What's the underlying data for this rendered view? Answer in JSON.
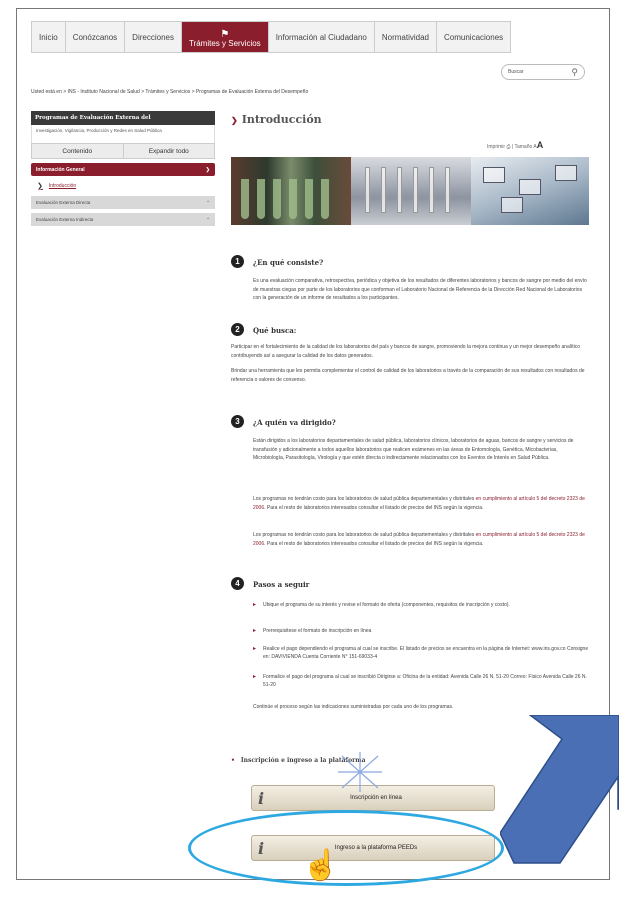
{
  "nav": {
    "items": [
      "Inicio",
      "Conózcanos",
      "Direcciones",
      "Trámites y Servicios",
      "Información al Ciudadano",
      "Normatividad",
      "Comunicaciones"
    ],
    "active_index": 3
  },
  "search": {
    "placeholder": "Buscar"
  },
  "breadcrumb": "Usted está en > INS - Instituto Nacional de Salud > Trámites y Servicios > Programas de Evaluación Externa del Desempeño",
  "sidebar": {
    "title": "Programas de Evaluación Externa del",
    "subtitle": "Investigación, Vigilancia, Producción y Redes en Salud Pública",
    "contents_label": "Contenido",
    "expand_label": "Expandir todo",
    "general_info": "Información General",
    "intro_link": "Introducción",
    "sections": [
      "Evaluación Externa Directa",
      "Evaluación Externa Indirecta"
    ]
  },
  "main": {
    "title": "Introducción",
    "print_label": "Imprimir",
    "size_label": "Tamaño",
    "steps": [
      {
        "num": "1",
        "title": "¿En qué consiste?",
        "text": "Es una evaluación comparativa, retrospectiva, periódica y objetiva de los resultados de diferentes laboratorios y bancos de sangre por medio del envío de muestras ciegas por parte de los laboratorios que conforman el Laboratorio Nacional de Referencia de la Dirección Red Nacional de Laboratorios con la generación de un informe de resultados a los participantes."
      },
      {
        "num": "2",
        "title": "Qué busca:",
        "text": "Participar en el fortalecimiento de la calidad de los laboratorios del país y bancos de sangre, promoviendo la mejora continua y un mejor desempeño analítico contribuyendo así a asegurar la calidad de los datos generados.",
        "text2": "Brindar una herramienta que les permita complementar el control de calidad de los laboratorios a través de la comparación de sus resultados con resultados de referencia o valores de consenso."
      },
      {
        "num": "3",
        "title": "¿A quién va dirigido?",
        "text": "Están dirigidos a los laboratorios departamentales de salud pública, laboratorios clínicos, laboratorios de aguas, bancos de sangre y servicios de transfusión y adicionalmente a todos aquellos laboratorios que realicen exámenes en las áreas de Entomología, Genética, Micobacterias, Microbiología, Parasitología, Virología y que estén directa o indirectamente relacionados con los Eventos de Interés en Salud Pública.",
        "text2_pre": "Los programas no tendrán costo para los laboratorios de salud pública departementales y distritales ",
        "text2_link": "en cumplimiento al artículo 5 del decreto 2323 de 2006",
        "text2_post": ". Para el resto de laboratorios interesados consultar el listado de precios del INS según la vigencia.",
        "text3_pre": "Los programas no tendrán costo para los laboratorios de salud pública departementales y distritales ",
        "text3_link": "en cumplimiento al artículo 5 del decreto 2323 de 2006",
        "text3_post": ". Para el resto de laboratorios interesados consultar el listado de precios del INS según la vigencia."
      },
      {
        "num": "4",
        "title": "Pasos a seguir",
        "bullets": [
          "Ubique el programa de su interés y revise el formato de oferta (componentes, requisitos de inscripción y costo).",
          "Prerrequisitese el formato de inscripción en línea",
          "Realice el pago dependiendo el programa al cual se inscribe. El listado de precios se encuentra en la página de Internet: www.ins.gov.co Consigne en: DAVIVIENDA Cuenta Corriente N° 151-69033-4",
          "Formalice el pago del programa al cual se inscribió Dirigirse a: Oficina de la entidad: Avenida Calle 26 N. 51-20 Correo: Físico Avenida Calle 26 N. 51-20"
        ],
        "closing": "Continúe el proceso según las indicaciones suministradas por cada uno de los programas."
      }
    ],
    "insc_heading": "Inscripción e ingreso a la plataforma",
    "btn_online": "Inscripción en línea",
    "btn_platform": "Ingreso a la plataforma PEEDs",
    "info_glyph": "i"
  },
  "colors": {
    "brand": "#8b1e2d",
    "highlight": "#2ea8e0",
    "arrow": "#4a6fb5"
  }
}
